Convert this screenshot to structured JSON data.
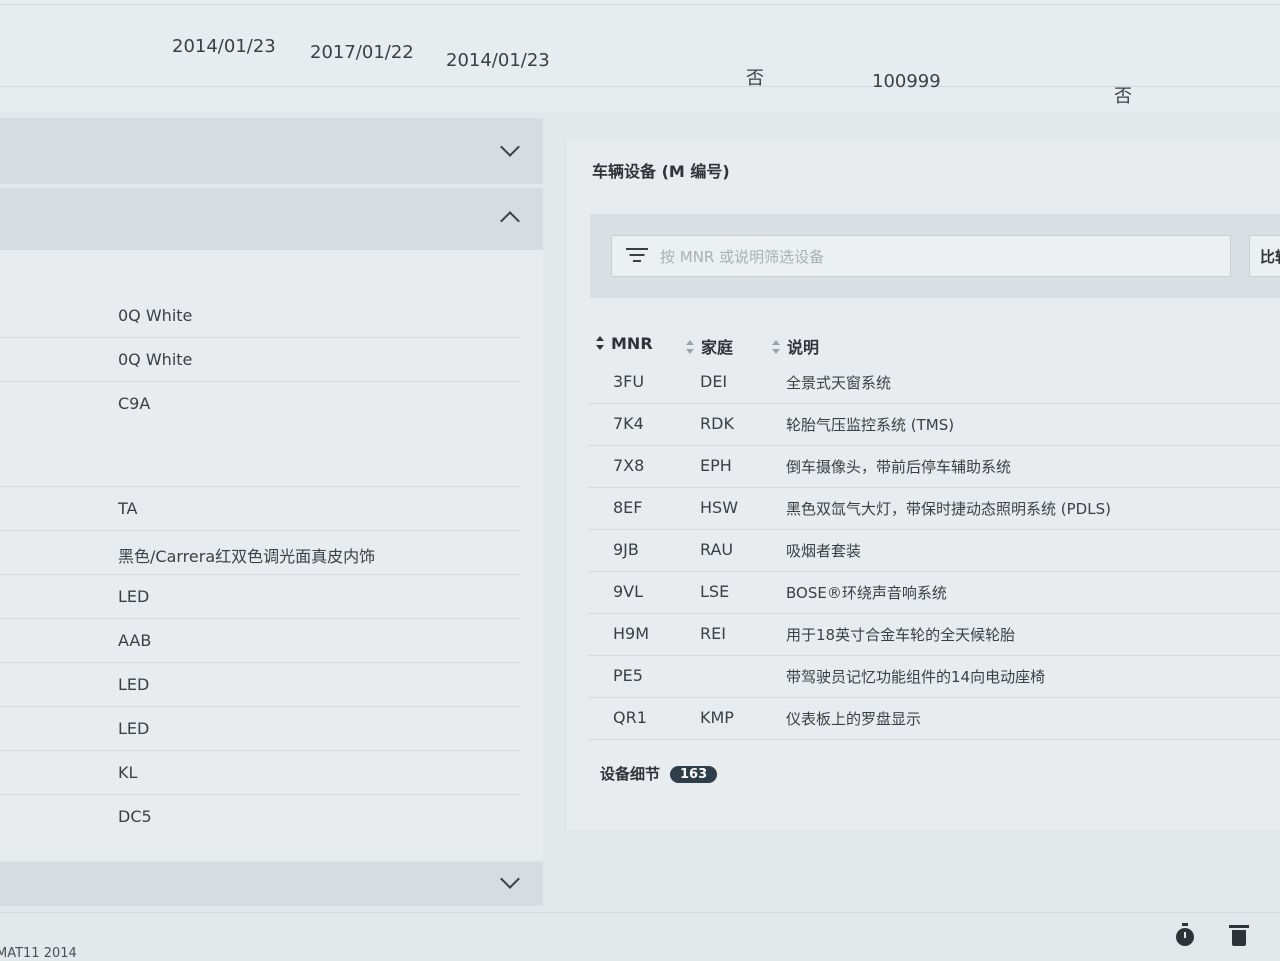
{
  "top_row": {
    "date_1": "2014/01/23",
    "date_2": "2017/01/22",
    "date_3": "2014/01/23",
    "flag_1": "否",
    "number": "100999",
    "flag_2": "否"
  },
  "left_panel": {
    "items": [
      "0Q White",
      "0Q White",
      "C9A",
      "TA",
      "黑色/Carrera红双色调光面真皮内饰",
      "LED",
      "AAB",
      "LED",
      "LED",
      "KL",
      "DC5"
    ]
  },
  "right_panel": {
    "title": "车辆设备 (M 编号)",
    "filter_placeholder": "按 MNR 或说明筛选设备",
    "compare_label": "比较",
    "columns": {
      "mnr": "MNR",
      "family": "家庭",
      "description": "说明"
    },
    "rows": [
      {
        "mnr": "3FU",
        "family": "DEI",
        "description": "全景式天窗系统"
      },
      {
        "mnr": "7K4",
        "family": "RDK",
        "description": "轮胎气压监控系统 (TMS)"
      },
      {
        "mnr": "7X8",
        "family": "EPH",
        "description": "倒车摄像头，带前后停车辅助系统"
      },
      {
        "mnr": "8EF",
        "family": "HSW",
        "description": "黑色双氙气大灯，带保时捷动态照明系统 (PDLS)"
      },
      {
        "mnr": "9JB",
        "family": "RAU",
        "description": "吸烟者套装"
      },
      {
        "mnr": "9VL",
        "family": "LSE",
        "description": "BOSE®环绕声音响系统"
      },
      {
        "mnr": "H9M",
        "family": "REI",
        "description": "用于18英寸合金车轮的全天候轮胎"
      },
      {
        "mnr": "PE5",
        "family": "",
        "description": "带驾驶员记忆功能组件的14向电动座椅"
      },
      {
        "mnr": "QR1",
        "family": "KMP",
        "description": "仪表板上的罗盘显示"
      }
    ],
    "details_label": "设备细节",
    "details_count": "163"
  },
  "footer": {
    "text": "MAT11 2014"
  },
  "icons": {
    "filter": "filter-icon",
    "sort": "sort-icon",
    "chevron": "chevron-icon",
    "timer": "stopwatch-icon",
    "trash": "trash-icon"
  }
}
